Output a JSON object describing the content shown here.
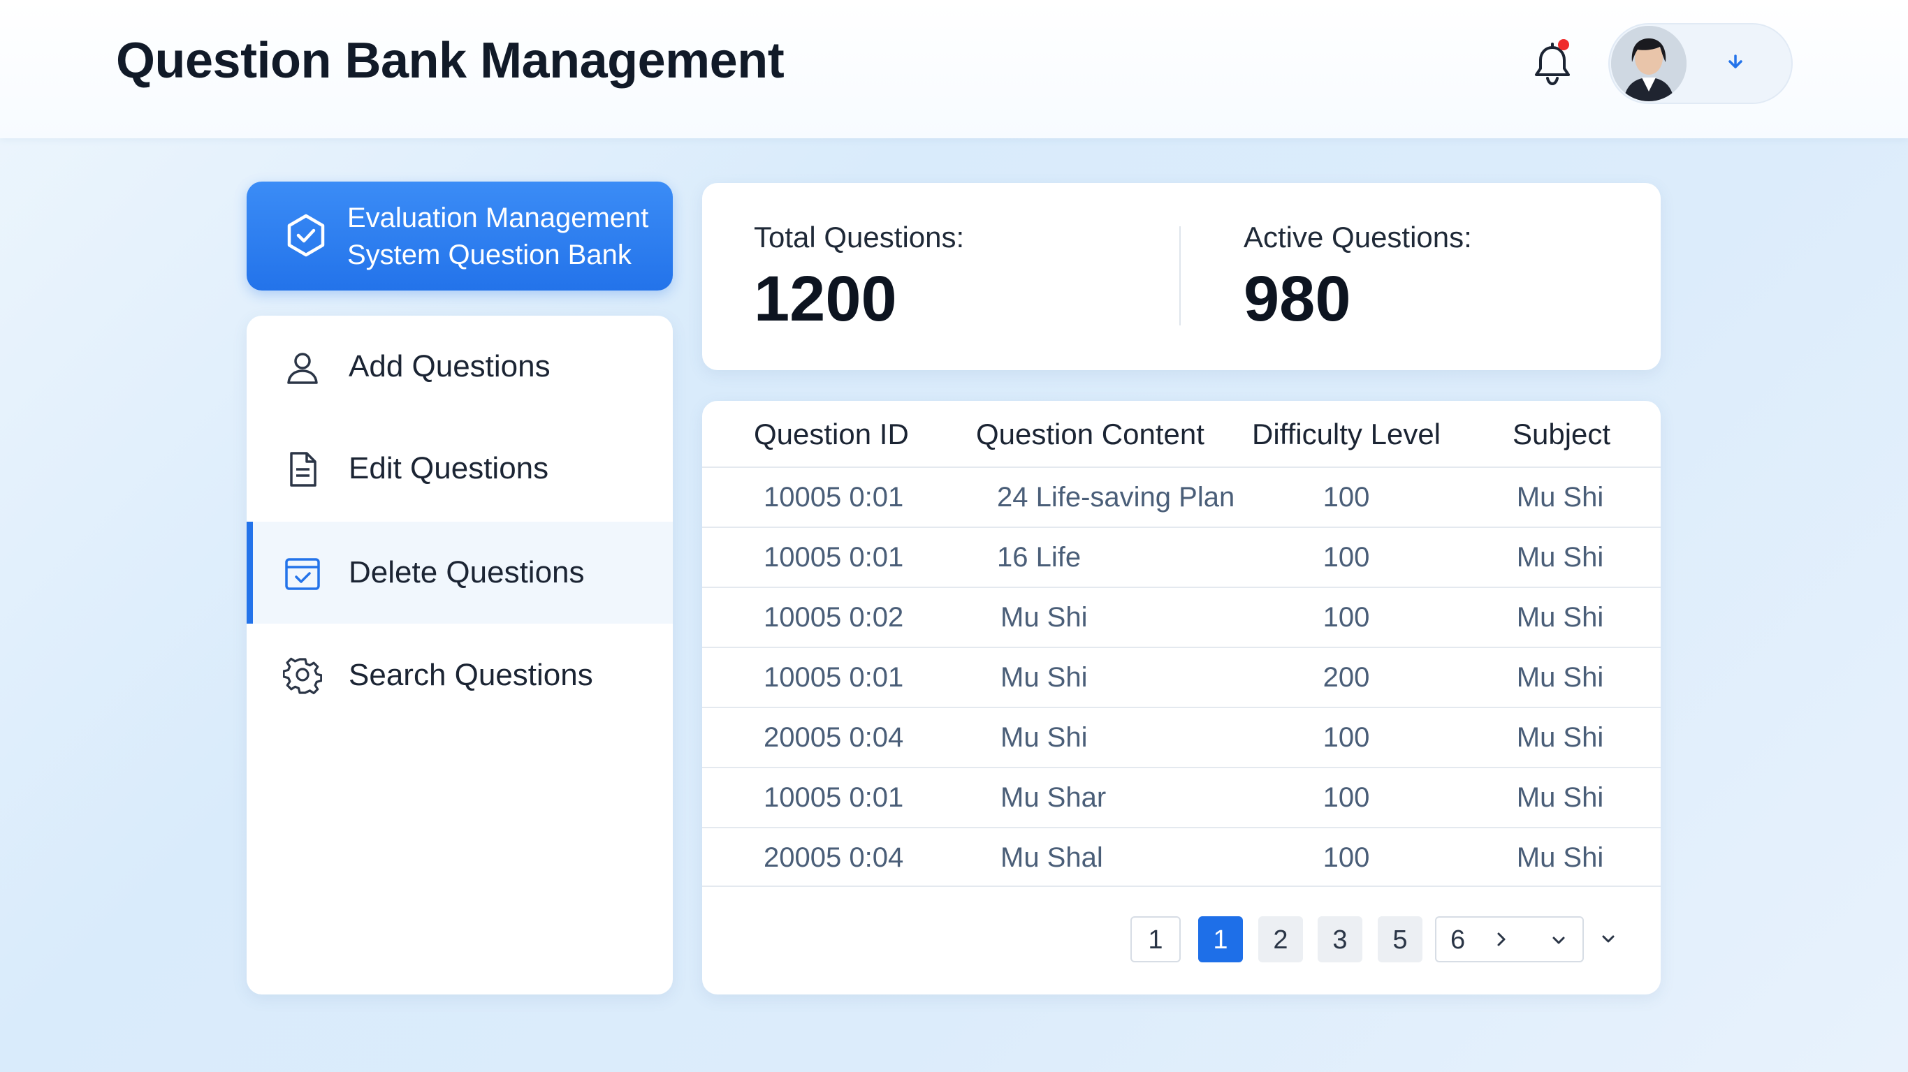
{
  "header": {
    "title": "Question Bank Management",
    "has_notification": true,
    "icons": {
      "notifications": "bell-icon",
      "user_menu": "chevron-down-icon"
    }
  },
  "sidebar": {
    "brand": {
      "label": "Evaluation Management System Question Bank",
      "line1": "Evaluation Management",
      "line2": "System Question Bank",
      "icon": "hexagon-check-icon"
    },
    "items": [
      {
        "label": "Add Questions",
        "icon": "user-icon",
        "active": false
      },
      {
        "label": "Edit Questions",
        "icon": "document-icon",
        "active": false
      },
      {
        "label": "Delete Questions",
        "icon": "calendar-check-icon",
        "active": true
      },
      {
        "label": "Search Questions",
        "icon": "gear-icon",
        "active": false
      }
    ]
  },
  "stats": {
    "total": {
      "label": "Total Questions:",
      "value": "1200"
    },
    "active": {
      "label": "Active Questions:",
      "value": "980"
    }
  },
  "table": {
    "columns": [
      "Question ID",
      "Question Content",
      "Difficulty Level",
      "Subject"
    ],
    "rows": [
      [
        "10005 0:01",
        "24 Life-saving Plan",
        "100",
        "Mu Shi"
      ],
      [
        "10005 0:01",
        "16 Life",
        "100",
        "Mu Shi"
      ],
      [
        "10005 0:02",
        "Mu Shi",
        "100",
        "Mu Shi"
      ],
      [
        "10005 0:01",
        "Mu Shi",
        "200",
        "Mu Shi"
      ],
      [
        "20005 0:04",
        "Mu Shi",
        "100",
        "Mu Shi"
      ],
      [
        "10005 0:01",
        "Mu Shar",
        "100",
        "Mu Shi"
      ],
      [
        "20005 0:04",
        "Mu Shal",
        "100",
        "Mu Shi"
      ]
    ]
  },
  "pagination": {
    "pages": [
      "1",
      "1",
      "2",
      "3",
      "5"
    ],
    "current_index": 1,
    "select_value": "6",
    "icons": {
      "next": "chevron-right-icon",
      "dropdown": "chevron-down-icon"
    }
  },
  "colors": {
    "accent": "#2373ea",
    "notification_dot": "#ef2b2b",
    "background": "#dcecfb"
  }
}
